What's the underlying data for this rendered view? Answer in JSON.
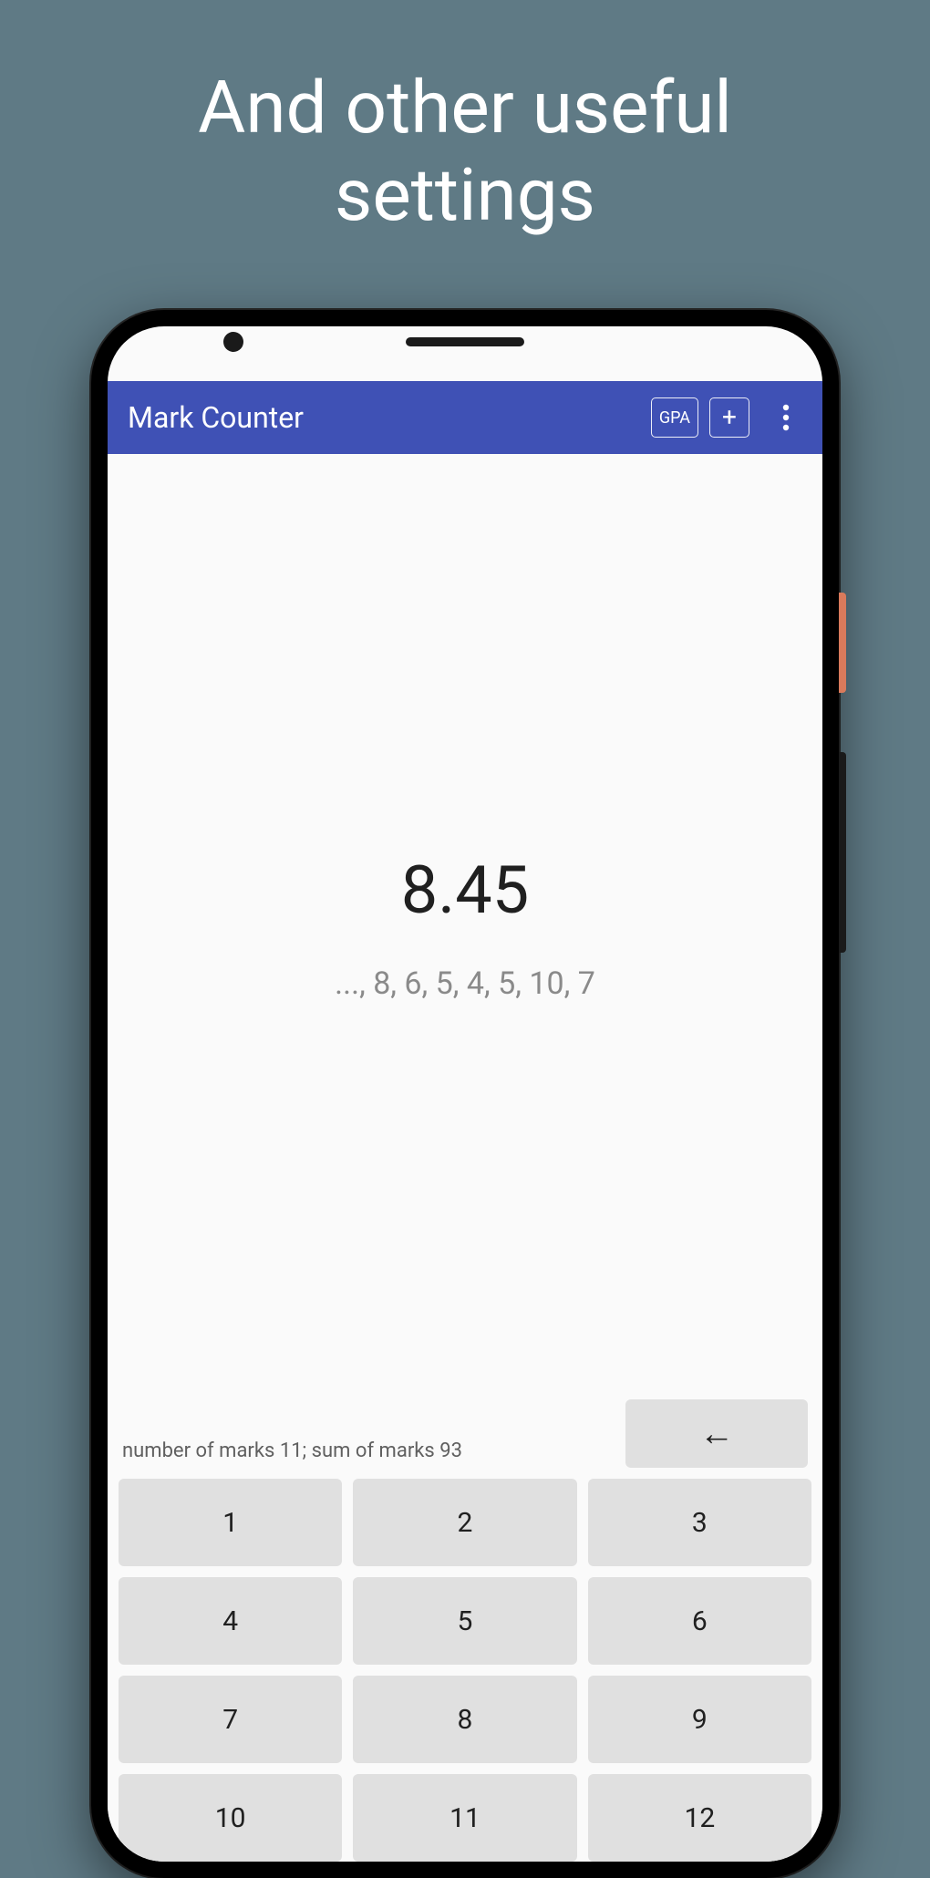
{
  "promo": {
    "line1": "And other useful",
    "line2": "settings"
  },
  "appbar": {
    "title": "Mark Counter",
    "gpa_label": "GPA",
    "plus_label": "+"
  },
  "display": {
    "average": "8.45",
    "sequence": "..., 8, 6, 5, 4, 5, 10, 7"
  },
  "stats": {
    "text": "number of marks 11;  sum of marks 93"
  },
  "backspace": {
    "glyph": "←"
  },
  "keypad": {
    "keys": [
      "1",
      "2",
      "3",
      "4",
      "5",
      "6",
      "7",
      "8",
      "9",
      "10",
      "11",
      "12"
    ]
  }
}
